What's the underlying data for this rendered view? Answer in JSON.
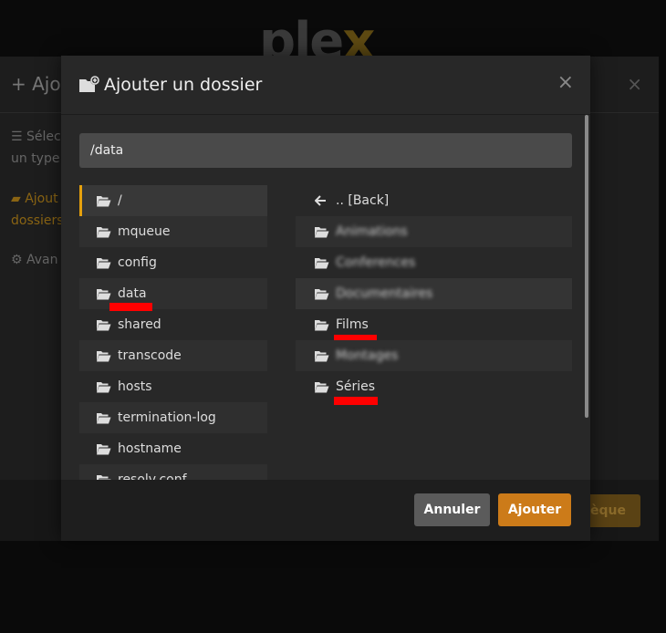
{
  "background": {
    "logo_main": "ple",
    "logo_x": "x",
    "title": "+ Ajou",
    "close": "×",
    "step1_line1": "☰ Sélec",
    "step1_line2": "un type",
    "step2_line1": "Ajout",
    "step2_line2": "dossiers",
    "step3": "⚙ Avan",
    "action_label": "hèque"
  },
  "modal": {
    "title": "Ajouter un dossier",
    "close": "×",
    "path_value": "/data",
    "left_folders": [
      {
        "label": "/"
      },
      {
        "label": "mqueue"
      },
      {
        "label": "config"
      },
      {
        "label": "data"
      },
      {
        "label": "shared"
      },
      {
        "label": "transcode"
      },
      {
        "label": "hosts"
      },
      {
        "label": "termination-log"
      },
      {
        "label": "hostname"
      },
      {
        "label": "resolv.conf"
      }
    ],
    "right_back": ".. [Back]",
    "right_folders": [
      {
        "label": "Animations"
      },
      {
        "label": "Conferences"
      },
      {
        "label": "Documentaires"
      },
      {
        "label": "Films"
      },
      {
        "label": "Montages"
      },
      {
        "label": "Séries"
      }
    ],
    "cancel_label": "Annuler",
    "add_label": "Ajouter"
  },
  "colors": {
    "accent": "#e5a00d",
    "add_button": "#cc7b19",
    "cancel_button": "#5b5b5b",
    "modal_bg": "#282828"
  },
  "icons": {
    "title": "folder-plus-icon",
    "folder": "folder-icon",
    "folder_open": "folder-open-icon",
    "back": "arrow-left-icon",
    "close": "close-icon"
  }
}
